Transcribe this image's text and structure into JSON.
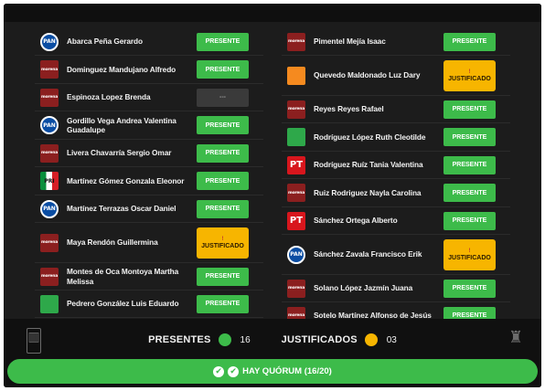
{
  "left_column": [
    {
      "name": "Abarca Peña Gerardo",
      "party_icon": "pan-icon",
      "party_abbr": "PAN",
      "status": "PRESENTE"
    },
    {
      "name": "Dominguez Mandujano Alfredo",
      "party_icon": "morena-icon",
      "party_abbr": "morena",
      "status": "PRESENTE"
    },
    {
      "name": "Espinoza Lopez Brenda",
      "party_icon": "morena-icon",
      "party_abbr": "morena",
      "status": "---"
    },
    {
      "name": "Gordillo Vega Andrea Valentina Guadalupe",
      "party_icon": "pan-icon",
      "party_abbr": "PAN",
      "status": "PRESENTE"
    },
    {
      "name": "Livera Chavarría Sergio Omar",
      "party_icon": "morena-icon",
      "party_abbr": "morena",
      "status": "PRESENTE"
    },
    {
      "name": "Martínez Gómez Gonzala Eleonor",
      "party_icon": "pri-icon",
      "party_abbr": "PRI",
      "status": "PRESENTE"
    },
    {
      "name": "Martínez Terrazas Oscar Daniel",
      "party_icon": "pan-icon",
      "party_abbr": "PAN",
      "status": "PRESENTE"
    },
    {
      "name": "Maya Rendón Guillermina",
      "party_icon": "morena-icon",
      "party_abbr": "morena",
      "status": "JUSTIFICADO"
    },
    {
      "name": "Montes de Oca Montoya Martha Melissa",
      "party_icon": "morena-icon",
      "party_abbr": "morena",
      "status": "PRESENTE"
    },
    {
      "name": "Pedrero González Luis Eduardo",
      "party_icon": "pvem-icon",
      "party_abbr": "",
      "status": "PRESENTE"
    }
  ],
  "right_column": [
    {
      "name": "Pimentel Mejía Isaac",
      "party_icon": "morena-icon",
      "party_abbr": "morena",
      "status": "PRESENTE"
    },
    {
      "name": "Quevedo Maldonado Luz Dary",
      "party_icon": "mc-icon",
      "party_abbr": "",
      "status": "JUSTIFICADO"
    },
    {
      "name": "Reyes Reyes Rafael",
      "party_icon": "morena-icon",
      "party_abbr": "morena",
      "status": "PRESENTE"
    },
    {
      "name": "Rodríguez López Ruth Cleotilde",
      "party_icon": "pvem-icon",
      "party_abbr": "",
      "status": "PRESENTE"
    },
    {
      "name": "Rodríguez Ruíz Tania Valentina",
      "party_icon": "pt-icon",
      "party_abbr": "PT",
      "status": "PRESENTE"
    },
    {
      "name": "Ruiz Rodriguez Nayla Carolina",
      "party_icon": "morena-icon",
      "party_abbr": "morena",
      "status": "PRESENTE"
    },
    {
      "name": "Sánchez Ortega Alberto",
      "party_icon": "pt-icon",
      "party_abbr": "PT",
      "status": "PRESENTE"
    },
    {
      "name": "Sánchez Zavala Francisco Erik",
      "party_icon": "pan-icon",
      "party_abbr": "PAN",
      "status": "JUSTIFICADO"
    },
    {
      "name": "Solano López Jazmín Juana",
      "party_icon": "morena-icon",
      "party_abbr": "morena",
      "status": "PRESENTE"
    },
    {
      "name": "Sotelo Martínez Alfonso de Jesús",
      "party_icon": "morena-icon",
      "party_abbr": "morena",
      "status": "PRESENTE"
    }
  ],
  "summary": {
    "presentes_label": "PRESENTES",
    "presentes_count": "16",
    "justificados_label": "JUSTIFICADOS",
    "justificados_count": "03"
  },
  "quorum": {
    "text": "HAY QUÓRUM (16/20)"
  },
  "justificado_mark": "!",
  "colors": {
    "background": "#1c1c1c",
    "presente": "#3dbb4a",
    "justificado": "#f7b500",
    "pendiente": "#3a3a3a"
  }
}
